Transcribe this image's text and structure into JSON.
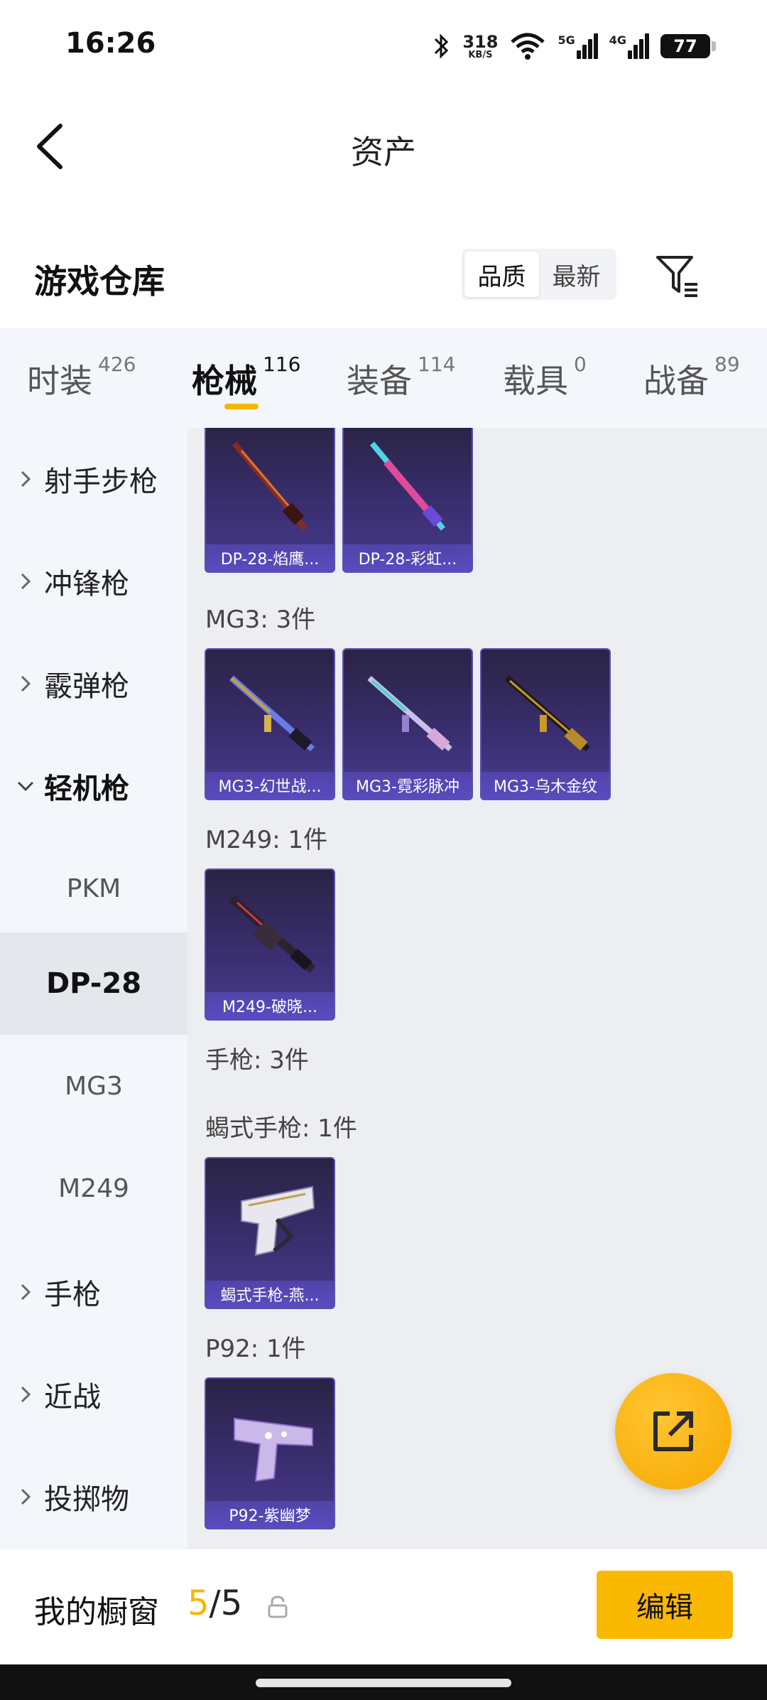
{
  "status_bar": {
    "time": "16:26",
    "net_speed": "318",
    "net_unit": "KB/S",
    "sim1": "5G",
    "sim2": "4G",
    "battery": "77"
  },
  "header": {
    "title": "资产"
  },
  "warehouse": {
    "title": "游戏仓库",
    "sort_options": [
      "品质",
      "最新"
    ],
    "sort_selected": "品质"
  },
  "tabs": [
    {
      "label": "时装",
      "count": "426"
    },
    {
      "label": "枪械",
      "count": "116",
      "active": true
    },
    {
      "label": "装备",
      "count": "114"
    },
    {
      "label": "载具",
      "count": "0"
    },
    {
      "label": "战备",
      "count": "89"
    }
  ],
  "sidebar": {
    "categories": [
      {
        "label": "射手步枪"
      },
      {
        "label": "冲锋枪"
      },
      {
        "label": "霰弹枪"
      },
      {
        "label": "轻机枪",
        "expanded": true
      },
      {
        "label": "手枪"
      },
      {
        "label": "近战"
      },
      {
        "label": "投掷物"
      }
    ],
    "subitems": [
      "PKM",
      "DP-28",
      "MG3",
      "M249"
    ],
    "selected_sub": "DP-28"
  },
  "content": {
    "groups": [
      {
        "label": "",
        "items": [
          "DP-28-焰鹰...",
          "DP-28-彩虹..."
        ]
      },
      {
        "label": "MG3: 3件",
        "items": [
          "MG3-幻世战...",
          "MG3-霓彩脉冲",
          "MG3-乌木金纹"
        ]
      },
      {
        "label": "M249: 1件",
        "items": [
          "M249-破晓..."
        ]
      },
      {
        "label": "手枪: 3件",
        "items": []
      },
      {
        "label": "蝎式手枪: 1件",
        "items": [
          "蝎式手枪-燕..."
        ]
      },
      {
        "label": "P92: 1件",
        "items": [
          "P92-紫幽梦"
        ]
      }
    ]
  },
  "bottom": {
    "my_window_label": "我的橱窗",
    "count_current": "5",
    "count_sep": "/",
    "count_total": "5",
    "edit_label": "编辑"
  },
  "colors": {
    "accent": "#f5b800",
    "card_bg": "#3b2f73"
  }
}
